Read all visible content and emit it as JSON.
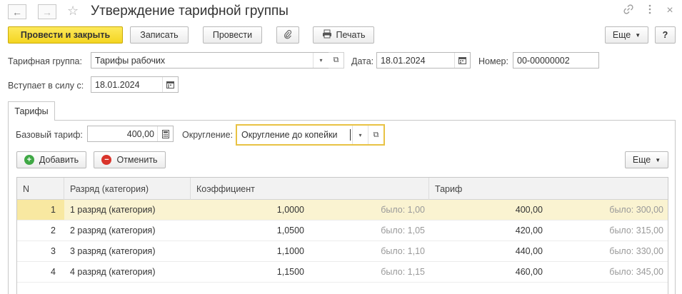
{
  "window": {
    "title": "Утверждение тарифной группы",
    "icons": {
      "back": "arrow-left-icon",
      "forward": "arrow-right-icon",
      "star": "star-icon",
      "link": "link-icon",
      "more": "vertical-dots-icon",
      "close": "close-icon"
    }
  },
  "toolbar": {
    "post_close": "Провести и закрыть",
    "save": "Записать",
    "post": "Провести",
    "attach_icon": "paperclip-icon",
    "print": "Печать",
    "print_icon": "printer-icon",
    "more": "Еще",
    "help": "?"
  },
  "form": {
    "tariff_group_label": "Тарифная группа:",
    "tariff_group_value": "Тарифы рабочих",
    "date_label": "Дата:",
    "date_value": "18.01.2024",
    "number_label": "Номер:",
    "number_value": "00-00000002",
    "effective_label": "Вступает в силу с:",
    "effective_value": "18.01.2024"
  },
  "tabs": [
    {
      "label": "Тарифы",
      "active": true
    }
  ],
  "tariffs": {
    "base_label": "Базовый тариф:",
    "base_value": "400,00",
    "rounding_label": "Округление:",
    "rounding_value": "Округление до копейки",
    "add": "Добавить",
    "cancel": "Отменить",
    "more": "Еще",
    "columns": {
      "n": "N",
      "grade": "Разряд (категория)",
      "coef": "Коэффициент",
      "tariff": "Тариф"
    },
    "rows": [
      {
        "n": "1",
        "grade": "1 разряд (категория)",
        "coef": "1,0000",
        "coef_was": "было: 1,00",
        "tariff": "400,00",
        "tariff_was": "было: 300,00",
        "selected": true
      },
      {
        "n": "2",
        "grade": "2 разряд (категория)",
        "coef": "1,0500",
        "coef_was": "было: 1,05",
        "tariff": "420,00",
        "tariff_was": "было: 315,00"
      },
      {
        "n": "3",
        "grade": "3 разряд (категория)",
        "coef": "1,1000",
        "coef_was": "было: 1,10",
        "tariff": "440,00",
        "tariff_was": "было: 330,00"
      },
      {
        "n": "4",
        "grade": "4 разряд (категория)",
        "coef": "1,1500",
        "coef_was": "было: 1,15",
        "tariff": "460,00",
        "tariff_was": "было: 345,00"
      }
    ]
  },
  "colors": {
    "primary_button": "#f4d521",
    "selected_row": "#faf3d1",
    "focus_border": "#e8c244",
    "add_green": "#3fa845",
    "cancel_red": "#d9342b"
  }
}
